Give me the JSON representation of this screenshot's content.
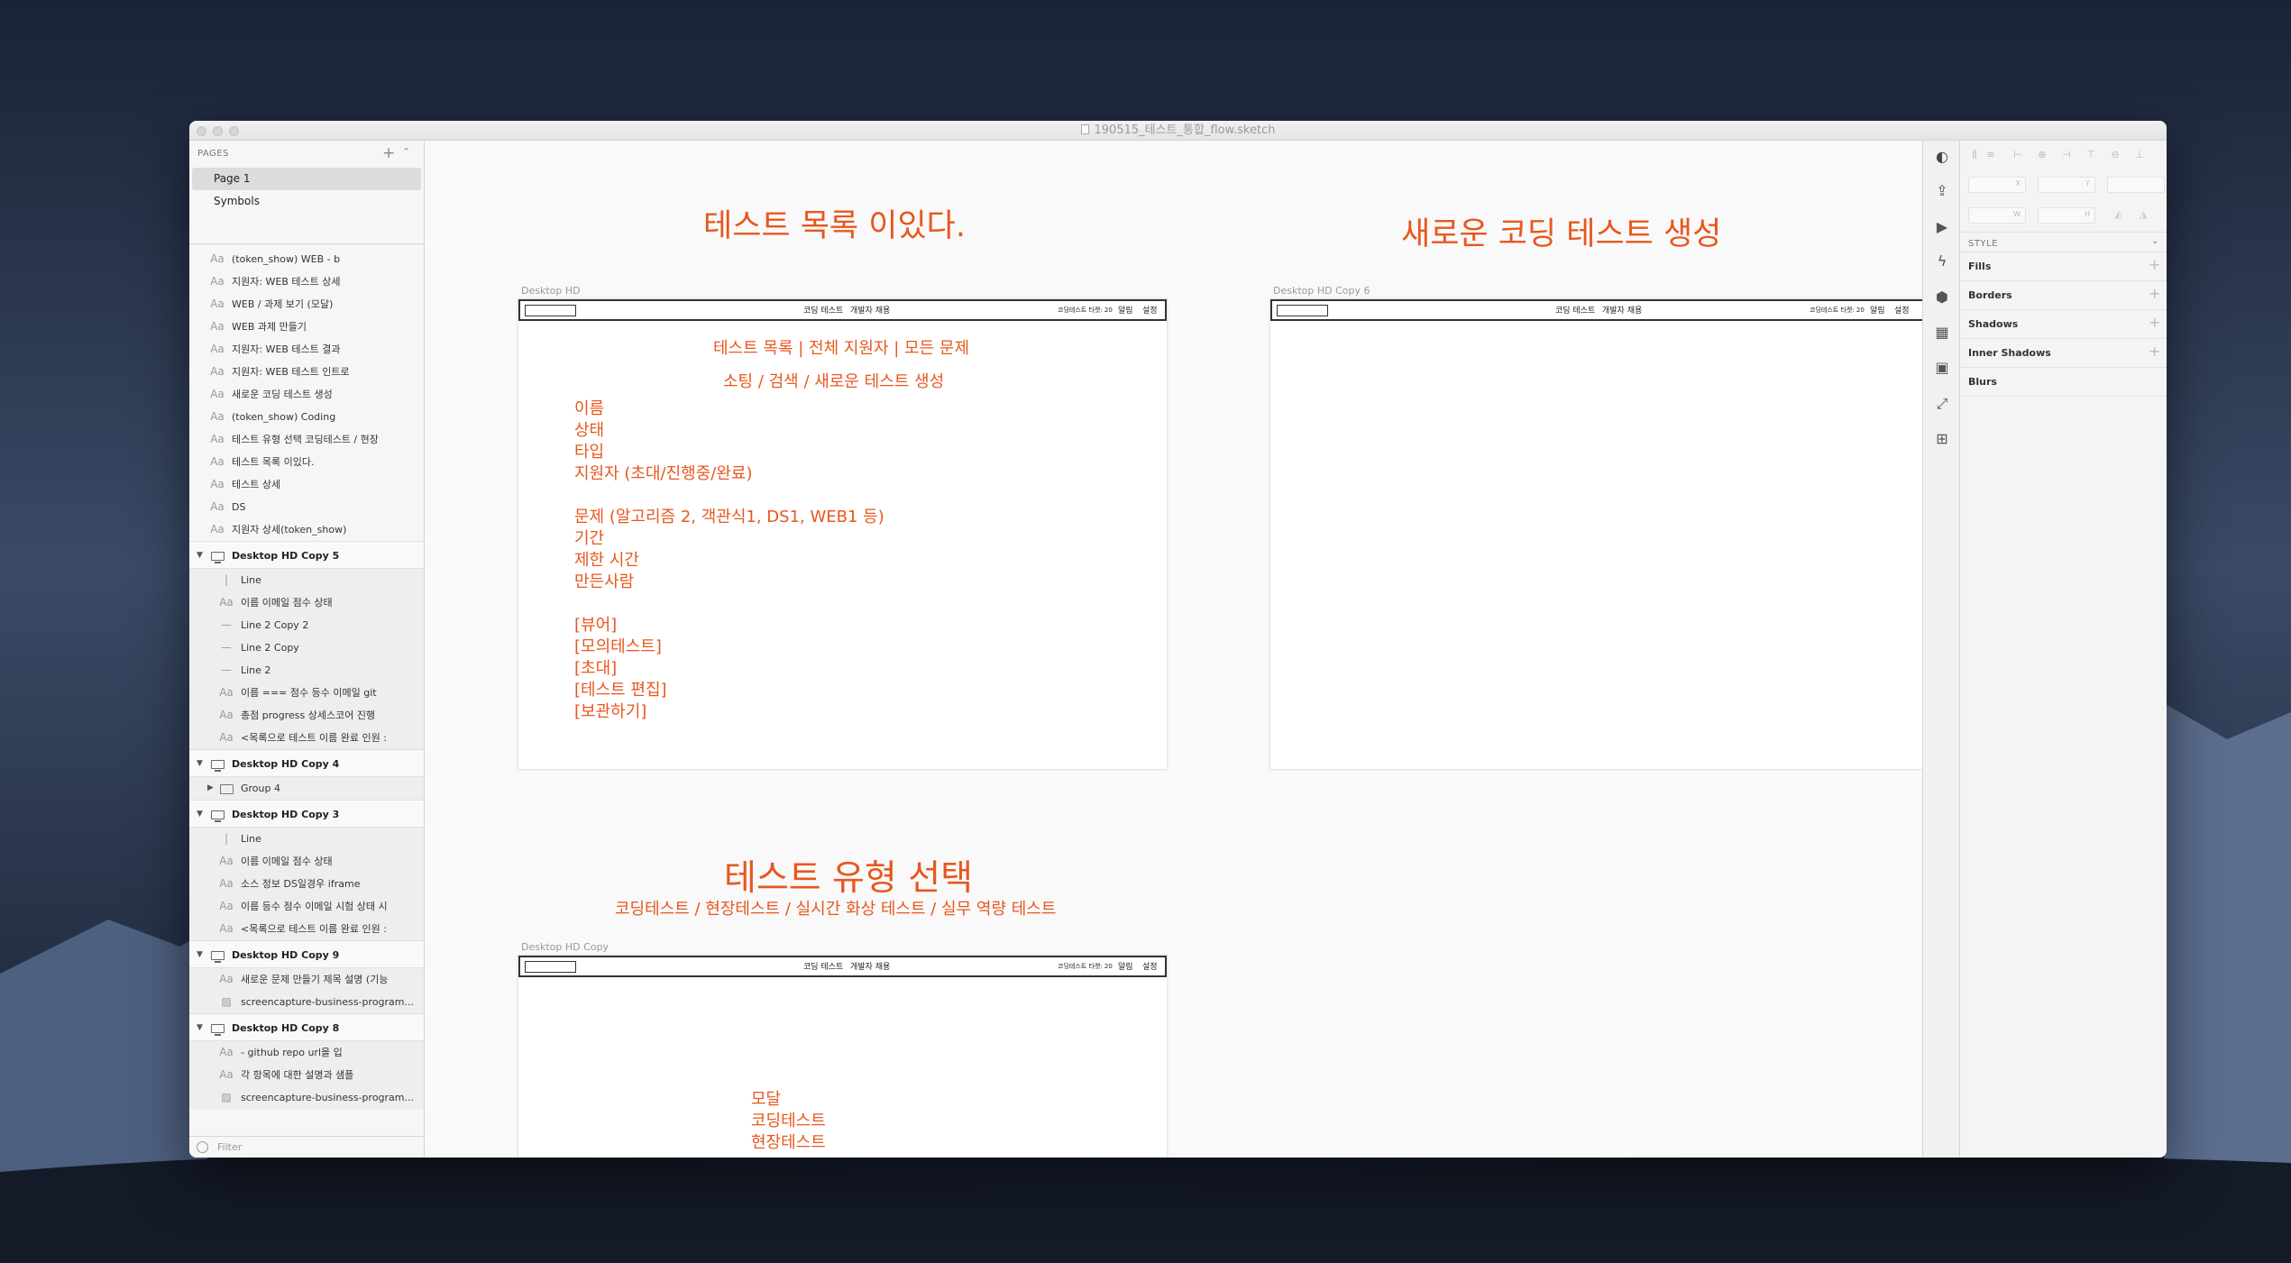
{
  "window": {
    "document_title": "190515_테스트_통합_flow.sketch"
  },
  "sidebar": {
    "pages_title": "PAGES",
    "add_icon": "plus-icon",
    "pages": [
      {
        "label": "Page 1",
        "selected": true
      },
      {
        "label": "Symbols",
        "selected": false
      }
    ],
    "top_layers": [
      "(token_show) WEB - b",
      "지원자: WEB 테스트 상세",
      "WEB / 과제 보기 (모달)",
      "WEB 과제 만들기",
      "지원자: WEB 테스트 결과",
      "지원자: WEB 테스트 인트로",
      "새로운 코딩 테스트 생성",
      "(token_show) Coding",
      "테스트 유형 선택 코딩테스트 / 현장",
      "테스트 목록 이있다.",
      "테스트 상세",
      "DS",
      "지원자 상세(token_show)"
    ],
    "groups": [
      {
        "name": "Desktop HD Copy 5",
        "children": [
          {
            "icon": "line-vertical-icon",
            "label": "Line"
          },
          {
            "icon": "text-icon",
            "label": "이름 이메일 점수 상태"
          },
          {
            "icon": "line-icon",
            "label": "Line 2 Copy 2"
          },
          {
            "icon": "line-icon",
            "label": "Line 2 Copy"
          },
          {
            "icon": "line-icon",
            "label": "Line 2"
          },
          {
            "icon": "text-icon",
            "label": "이름 === 점수 등수 이메일 git"
          },
          {
            "icon": "text-icon",
            "label": "총점 progress 상세스코어 진행"
          },
          {
            "icon": "text-icon",
            "label": "<목록으로 테스트 이름 완료 인원 :"
          }
        ]
      },
      {
        "name": "Desktop HD Copy 4",
        "children": [
          {
            "icon": "folder-icon",
            "label": "Group 4"
          }
        ]
      },
      {
        "name": "Desktop HD Copy 3",
        "children": [
          {
            "icon": "line-vertical-icon",
            "label": "Line"
          },
          {
            "icon": "text-icon",
            "label": "이름 이메일 점수 상태"
          },
          {
            "icon": "text-icon",
            "label": "소스 정보 DS일경우 iframe"
          },
          {
            "icon": "text-icon",
            "label": "이름 등수 점수 이메일 시험 상태 시"
          },
          {
            "icon": "text-icon",
            "label": "<목록으로 테스트 이름 완료 인원 :"
          }
        ]
      },
      {
        "name": "Desktop HD Copy 9",
        "children": [
          {
            "icon": "text-icon",
            "label": "새로운 문제 만들기 제목 설명 (기능"
          },
          {
            "icon": "image-icon",
            "label": "screencapture-business-program..."
          }
        ]
      },
      {
        "name": "Desktop HD Copy 8",
        "children": [
          {
            "icon": "text-icon",
            "label": "- github repo url을 입"
          },
          {
            "icon": "text-icon",
            "label": "각 항목에 대한 설명과 샘플"
          },
          {
            "icon": "image-icon",
            "label": "screencapture-business-program..."
          }
        ]
      }
    ],
    "filter_placeholder": "Filter"
  },
  "canvas": {
    "annotations": {
      "list_title": "테스트 목록 이있다.",
      "new_test_title": "새로운 코딩 테스트 생성",
      "type_title": "테스트 유형 선택",
      "type_subtitle": "코딩테스트 / 현장테스트 / 실시간 화상 테스트 / 실무 역량 테스트"
    },
    "navbar": {
      "link1": "코딩 테스트",
      "link2": "개발자 채용",
      "right1": "코딩테스트 타켓: 20",
      "right2": "알림",
      "right3": "설정"
    },
    "artboards": {
      "hd": {
        "label": "Desktop HD",
        "line1": "테스트 목록 | 전체 지원자 | 모든 문제",
        "line2": "소팅 / 검색 / 새로운 테스트 생성",
        "block": [
          "이름",
          "상태",
          "타입",
          "지원자 (초대/진행중/완료)",
          "",
          "문제 (알고리즘 2, 객관식1, DS1, WEB1 등)",
          "기간",
          "제한 시간",
          "만든사람",
          "",
          "[뷰어]",
          "[모의테스트]",
          "[초대]",
          "[테스트 편집]",
          "[보관하기]"
        ]
      },
      "copy6": {
        "label": "Desktop HD Copy 6"
      },
      "copy": {
        "label": "Desktop HD Copy",
        "block": [
          "모달",
          "코딩테스트",
          "현장테스트"
        ]
      }
    }
  },
  "inspector": {
    "fields": {
      "x": "X",
      "y": "Y",
      "w": "W",
      "h": "H"
    },
    "style_title": "STYLE",
    "sections": [
      "Fills",
      "Borders",
      "Shadows",
      "Inner Shadows",
      "Blurs"
    ]
  }
}
